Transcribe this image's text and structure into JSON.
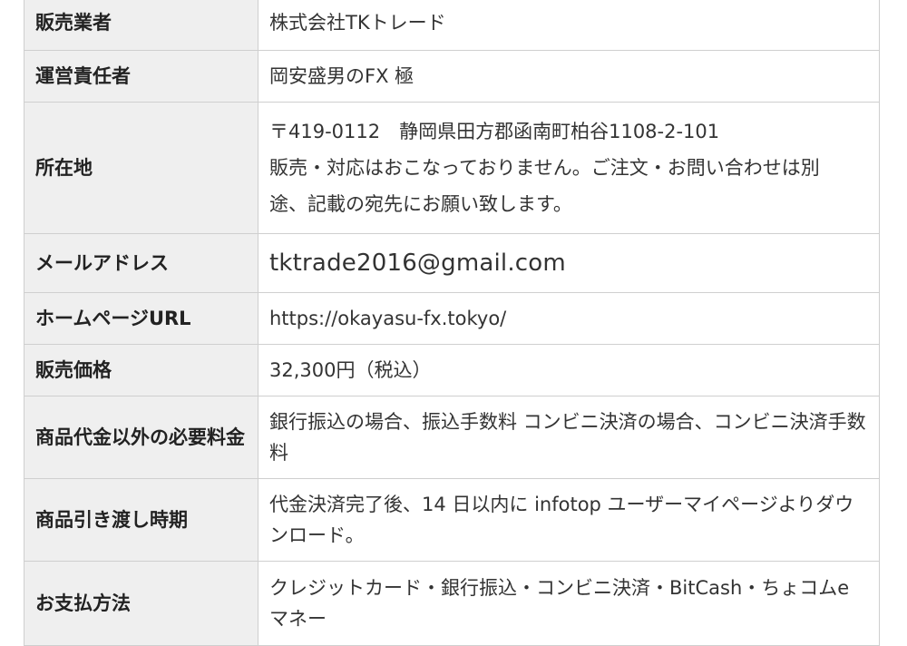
{
  "table": {
    "rows": [
      {
        "label": "販売業者",
        "value": "株式会社TKトレード"
      },
      {
        "label": "運営責任者",
        "value": "岡安盛男のFX 極"
      },
      {
        "label": "所在地",
        "lines": [
          "〒419-0112　静岡県田方郡函南町柏谷1108-2-101",
          "販売・対応はおこなっておりません。ご注文・お問い合わせは別",
          "途、記載の宛先にお願い致します。"
        ]
      },
      {
        "label": "メールアドレス",
        "value": "tktrade2016@gmail.com"
      },
      {
        "label": "ホームページURL",
        "value": "https://okayasu-fx.tokyo/"
      },
      {
        "label": "販売価格",
        "value": "32,300円（税込）"
      },
      {
        "label": "商品代金以外の必要料金",
        "value": "銀行振込の場合、振込手数料 コンビニ決済の場合、コンビニ決済手数料"
      },
      {
        "label": "商品引き渡し時期",
        "value": "代金決済完了後、14 日以内に infotop ユーザーマイページよりダウンロード。"
      },
      {
        "label": "お支払方法",
        "value": "クレジットカード・銀行振込・コンビニ決済・BitCash・ちょコムe マネー"
      }
    ]
  }
}
